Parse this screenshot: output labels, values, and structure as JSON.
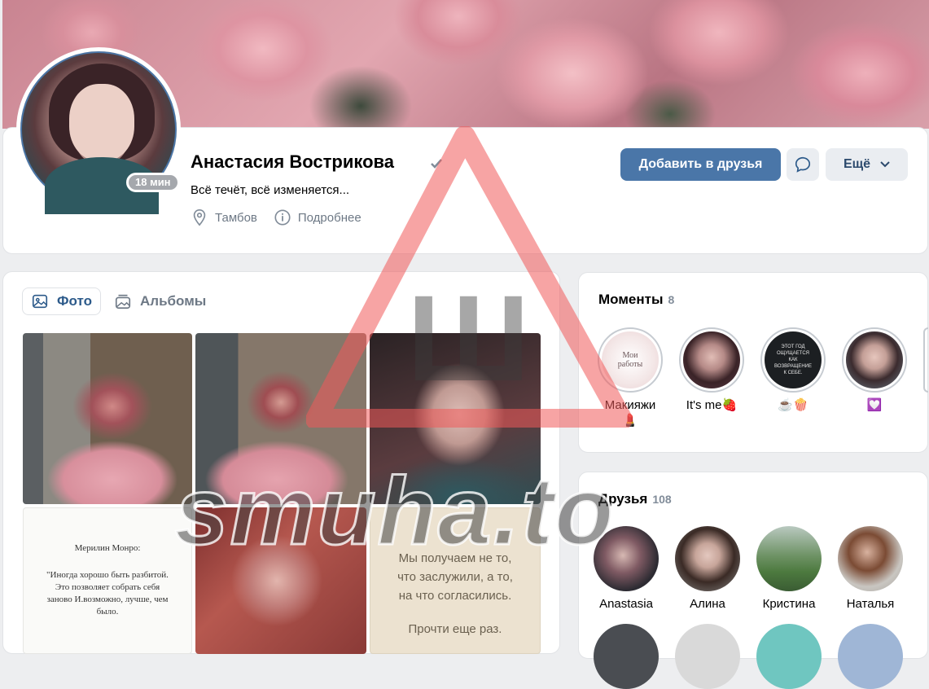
{
  "profile": {
    "name": "Анастасия Вострикова",
    "online": "18 мин",
    "status": "Всё течёт, всё изменяется...",
    "city": "Тамбов",
    "details": "Подробнее",
    "add_friend": "Добавить в друзья",
    "more": "Ещё"
  },
  "photos": {
    "tabs": [
      "Фото",
      "Альбомы"
    ],
    "quote_author": "Мерилин Монро:",
    "quote_text": "\"Иногда хорошо быть разбитой. Это позволяет собрать себя заново И.возможно, лучше, чем было.",
    "card_text_1": "Мы получаем не то, что заслужили, а то, на что согласились.",
    "card_text_2": "Прочти еще раз."
  },
  "moments": {
    "title": "Моменты",
    "count": "8",
    "items": [
      {
        "label": "Макияжи 💄",
        "thumb_text": "Мои работы"
      },
      {
        "label": "It's me🍓",
        "thumb_text": ""
      },
      {
        "label": "☕🍿",
        "thumb_text": "ЭТОТ ГОД ОЩУЩАЕТСЯ КАК ВОЗВРАЩЕНИЕ К СЕБЕ."
      },
      {
        "label": "💟",
        "thumb_text": ""
      }
    ]
  },
  "friends": {
    "title": "Друзья",
    "count": "108",
    "items": [
      "Anastasia",
      "Алина",
      "Кристина",
      "Наталья"
    ]
  },
  "watermark": {
    "text": "smuha.to",
    "sign": "Ш"
  }
}
